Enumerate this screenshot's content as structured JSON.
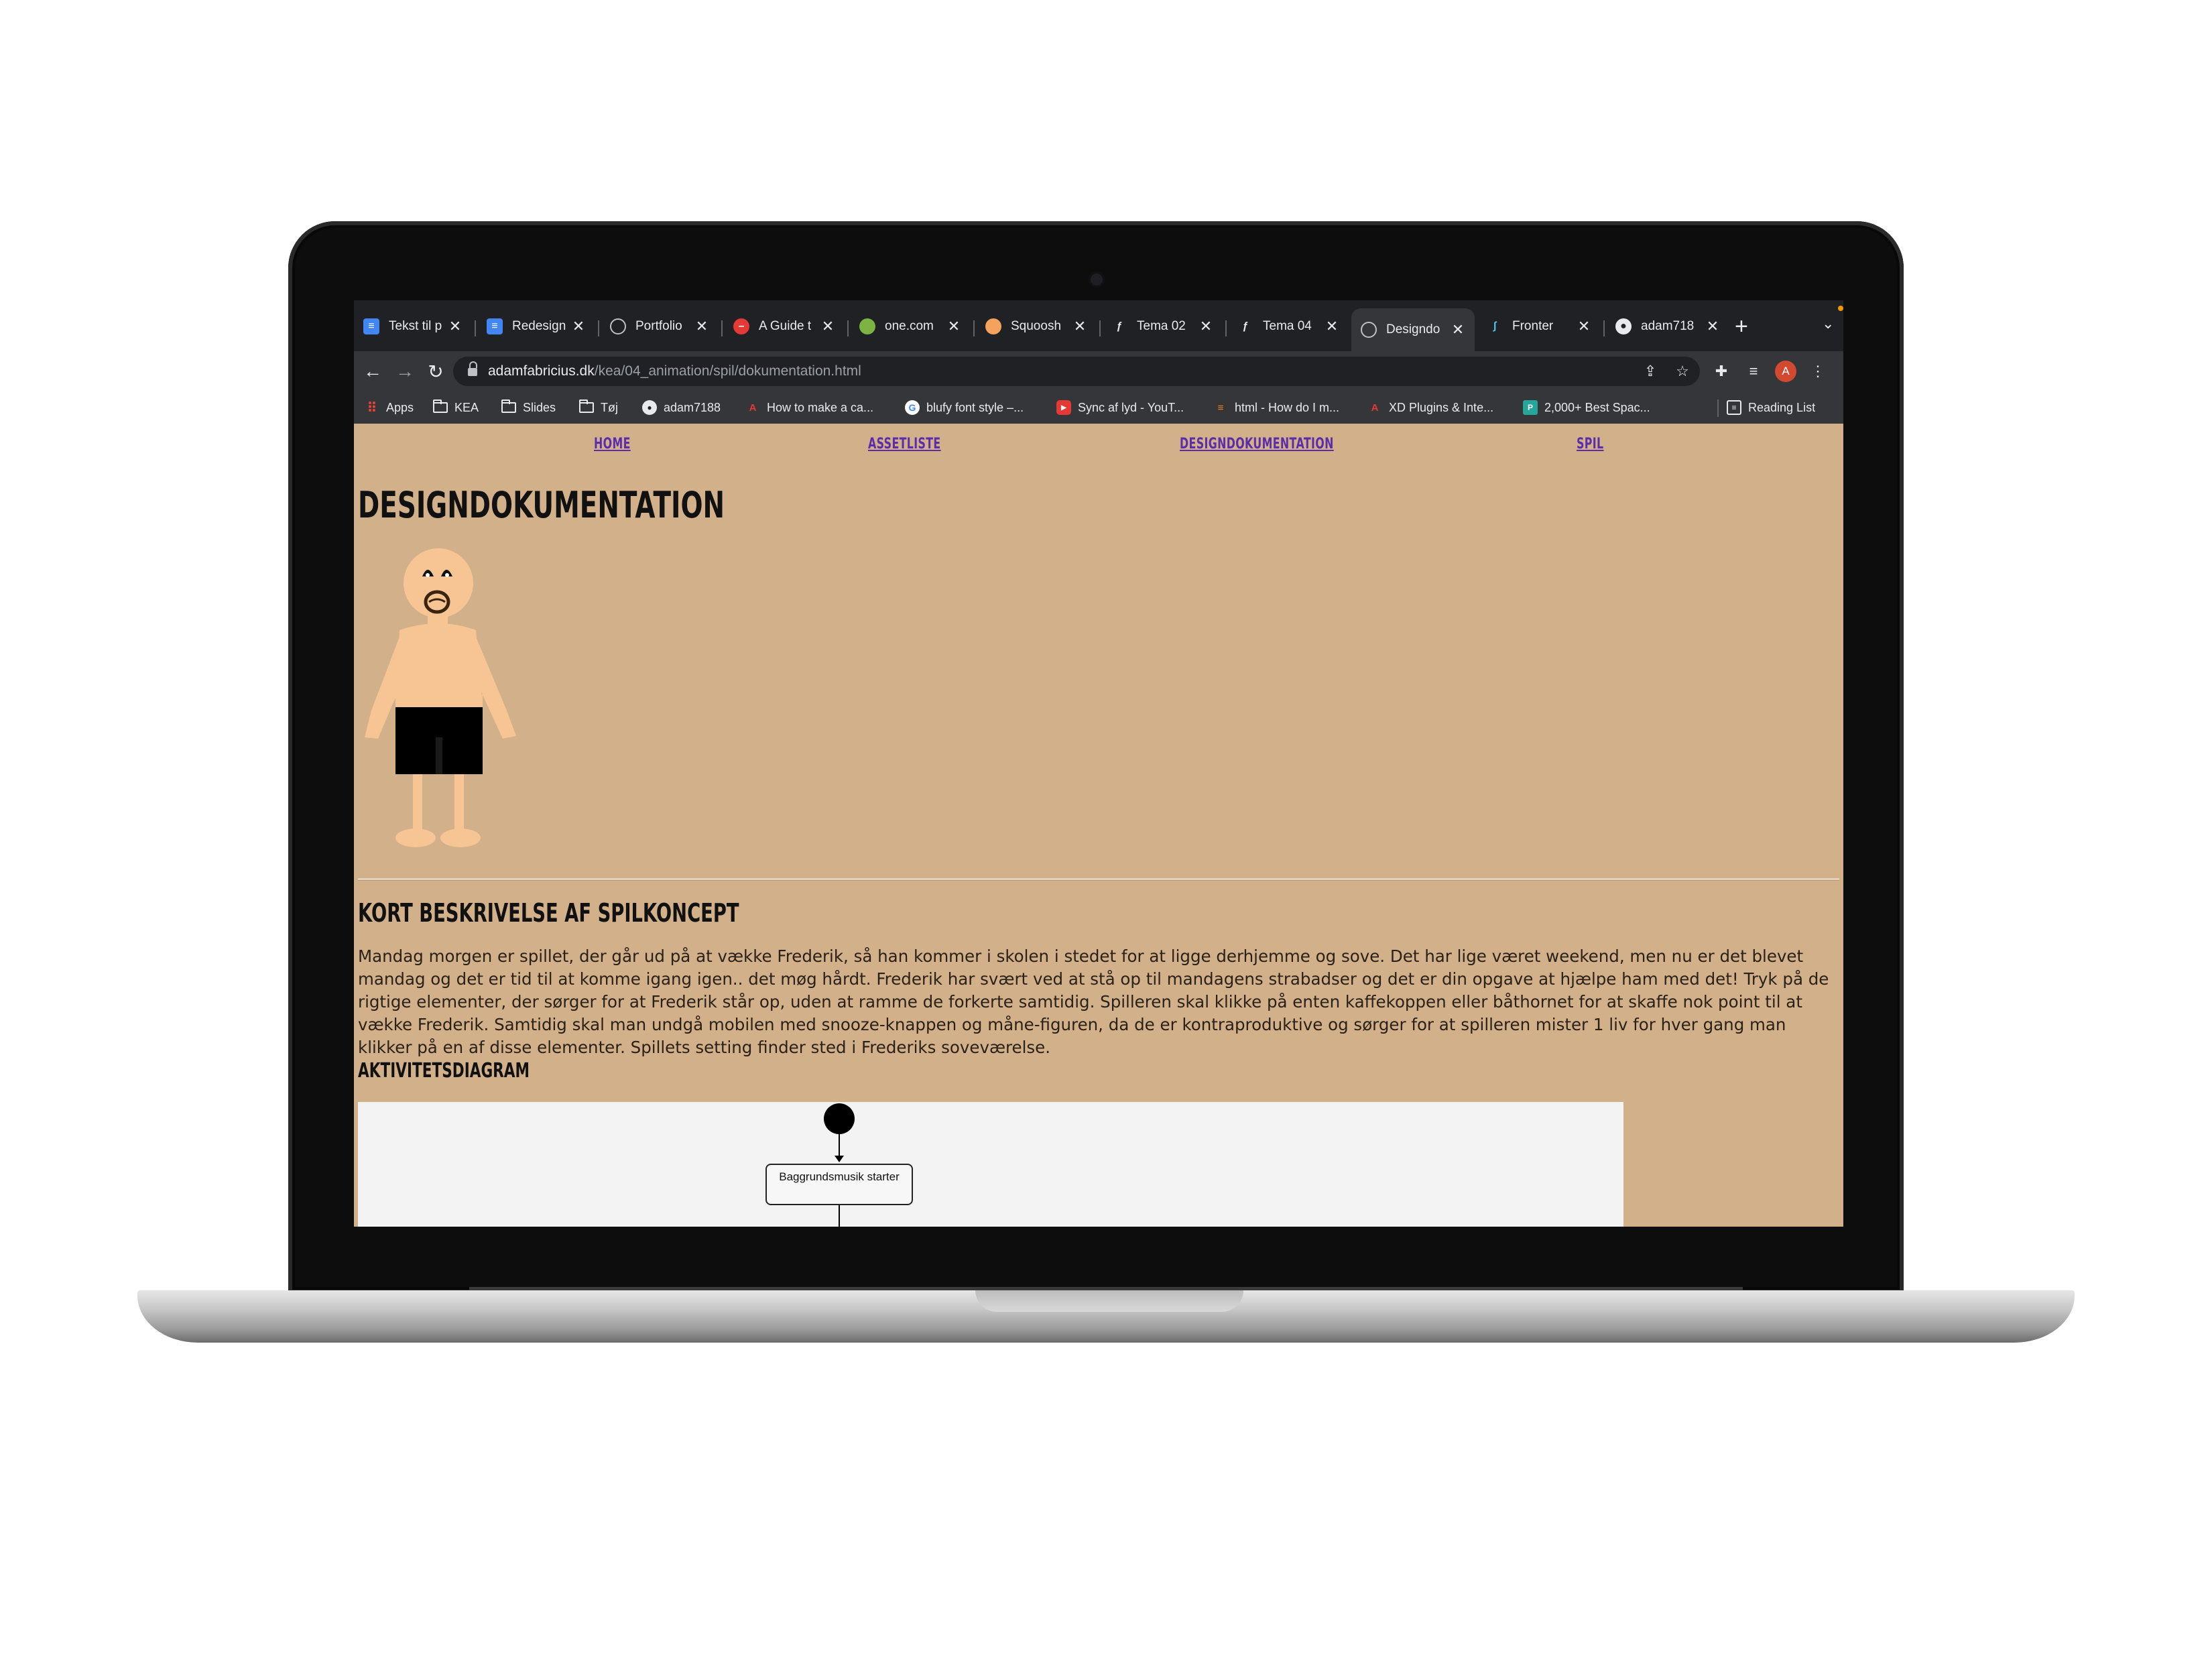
{
  "browser": {
    "tabs": [
      {
        "title": "Tekst til p",
        "icon": "docs-icon",
        "active": false
      },
      {
        "title": "Redesign",
        "icon": "docs-icon",
        "active": false
      },
      {
        "title": "Portfolio",
        "icon": "globe-icon",
        "active": false
      },
      {
        "title": "A Guide t",
        "icon": "block-icon",
        "active": false
      },
      {
        "title": "one.com",
        "icon": "onecom-icon",
        "active": false
      },
      {
        "title": "Squoosh",
        "icon": "squoosh-icon",
        "active": false
      },
      {
        "title": "Tema 02",
        "icon": "figma-icon",
        "active": false
      },
      {
        "title": "Tema 04",
        "icon": "figma-icon",
        "active": false
      },
      {
        "title": "Designdo",
        "icon": "globe-icon",
        "active": true
      },
      {
        "title": "Fronter",
        "icon": "fronter-icon",
        "active": false
      },
      {
        "title": "adam718",
        "icon": "github-icon",
        "active": false
      }
    ],
    "url_host": "adamfabricius.dk",
    "url_path": "/kea/04_animation/spil/dokumentation.html",
    "avatar_letter": "A",
    "bookmarks": [
      {
        "label": "Apps",
        "icon": "apps-grid-icon"
      },
      {
        "label": "KEA",
        "icon": "folder-icon"
      },
      {
        "label": "Slides",
        "icon": "folder-icon"
      },
      {
        "label": "Tøj",
        "icon": "folder-icon"
      },
      {
        "label": "adam7188",
        "icon": "github-icon"
      },
      {
        "label": "How to make a ca...",
        "icon": "adobe-icon"
      },
      {
        "label": "blufy font style –...",
        "icon": "google-icon"
      },
      {
        "label": "Sync af lyd - YouT...",
        "icon": "youtube-icon"
      },
      {
        "label": "html - How do I m...",
        "icon": "stackoverflow-icon"
      },
      {
        "label": "XD Plugins & Inte...",
        "icon": "adobe-icon"
      },
      {
        "label": "2,000+ Best Spac...",
        "icon": "photo-icon"
      }
    ],
    "reading_list": "Reading List"
  },
  "page": {
    "nav": [
      "HOME",
      "ASSETLISTE",
      "DESIGNDOKUMENTATION",
      "SPIL"
    ],
    "title": "DESIGNDOKUMENTATION",
    "section_title": "KORT BESKRIVELSE AF SPILKONCEPT",
    "paragraph": "Mandag morgen er spillet, der går ud på at vække Frederik, så han kommer i skolen i stedet for at ligge derhjemme og sove. Det har lige været weekend, men nu er det blevet mandag og det er tid til at komme igang igen.. det møg hårdt. Frederik har svært ved at stå op til mandagens strabadser og det er din opgave at hjælpe ham med det! Tryk på de rigtige elementer, der sørger for at Frederik står op, uden at ramme de forkerte samtidig. Spilleren skal klikke på enten kaffekoppen eller båthornet for at skaffe nok point til at vække Frederik. Samtidig skal man undgå mobilen med snooze-knappen og måne-figuren, da de er kontraproduktive og sørger for at spilleren mister 1 liv for hver gang man klikker på en af disse elementer. Spillets setting finder sted i Frederiks soveværelse.",
    "diagram_title": "AKTIVITETSDIAGRAM",
    "diagram_first_activity": "Baggrundsmusik starter"
  },
  "colors": {
    "page_bg": "#d1b08a",
    "link": "#5b2dab",
    "skin": "#f6c593",
    "shorts": "#000000"
  }
}
